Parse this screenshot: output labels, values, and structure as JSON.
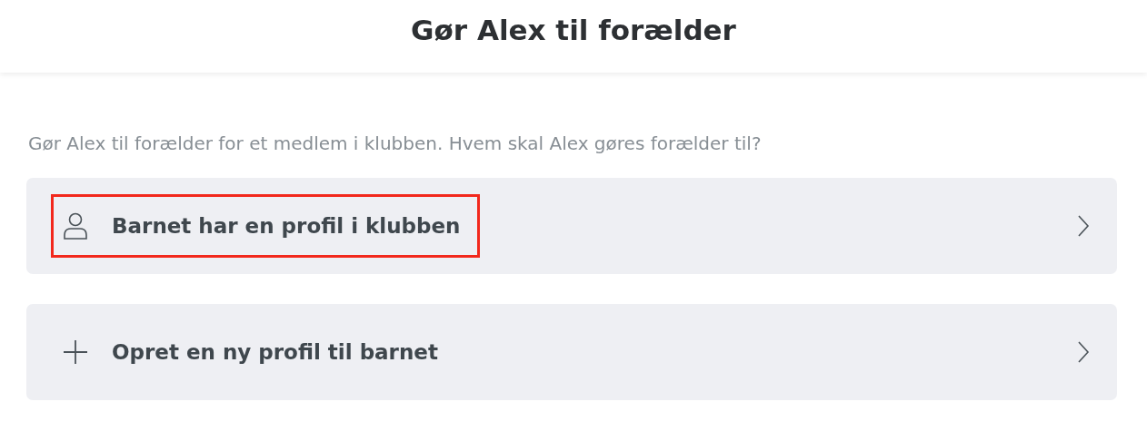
{
  "header": {
    "title": "Gør Alex til forælder"
  },
  "intro": "Gør Alex til forælder for et medlem i klubben. Hvem skal Alex gøres forælder til?",
  "options": [
    {
      "kind": "person",
      "label": "Barnet har en profil i klubben",
      "highlighted": true
    },
    {
      "kind": "plus",
      "label": "Opret en ny profil til barnet",
      "highlighted": false
    }
  ]
}
